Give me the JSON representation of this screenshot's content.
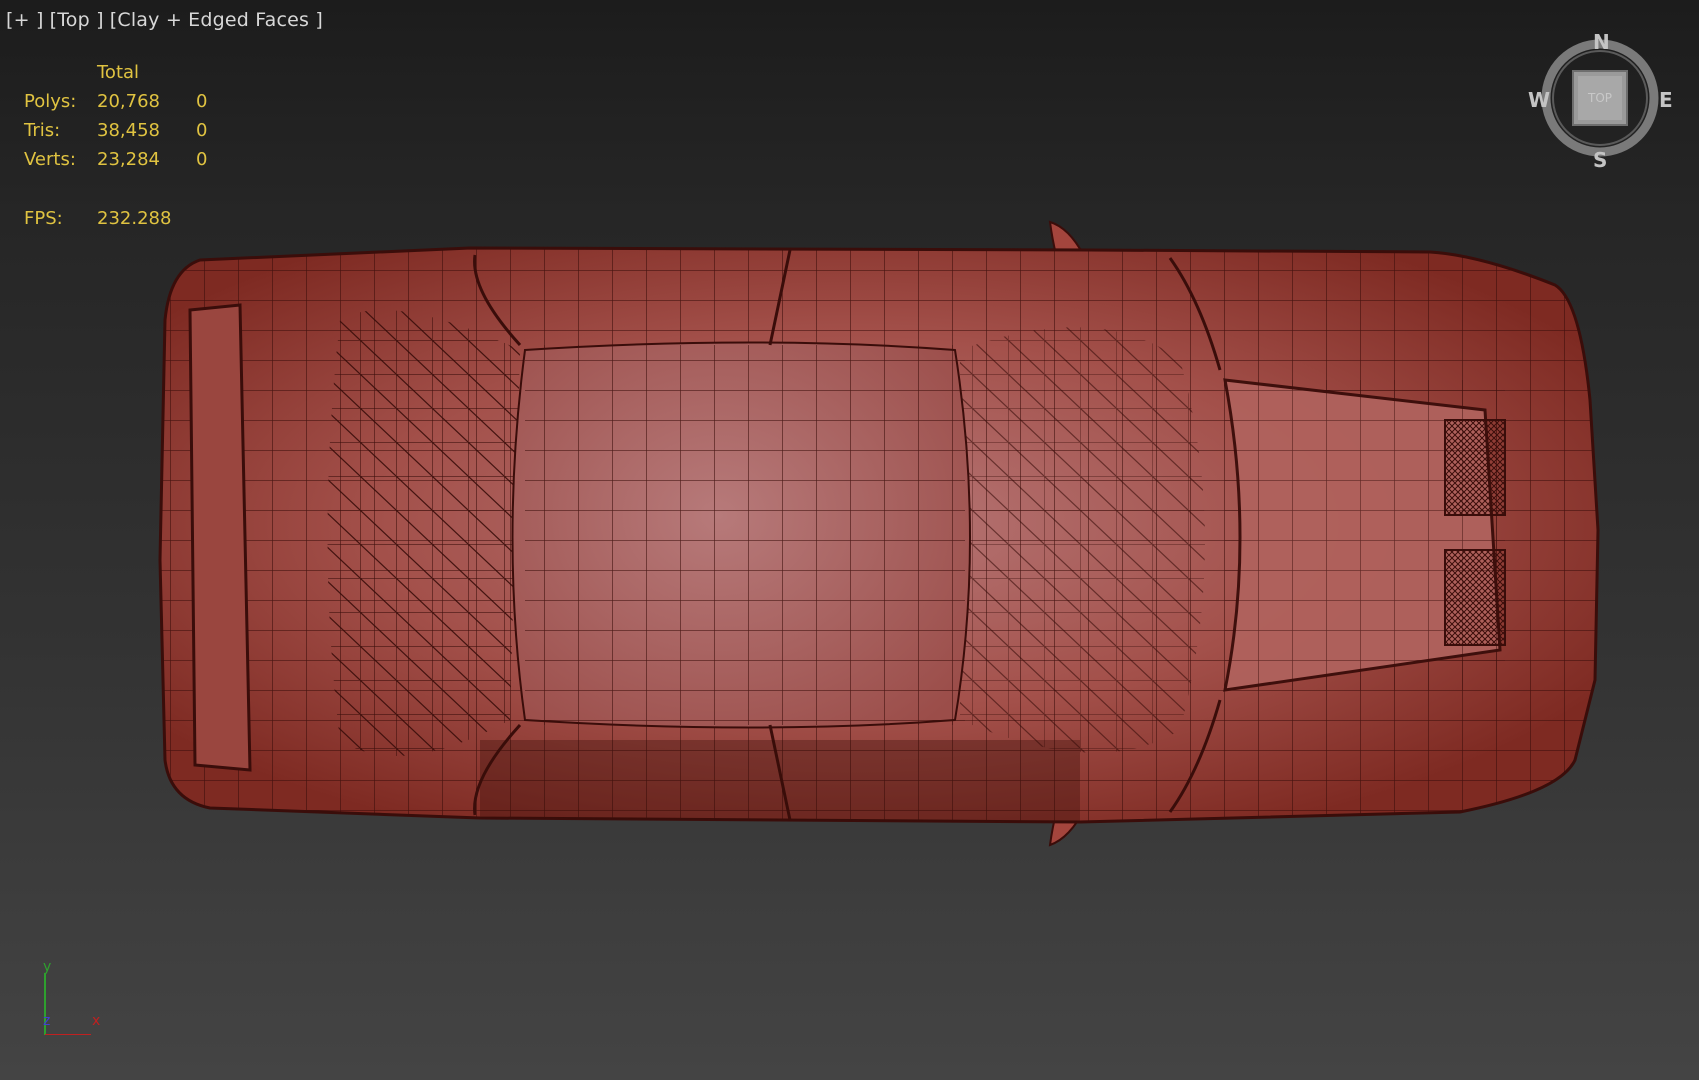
{
  "viewport": {
    "label_plus": "[+ ]",
    "label_view": "[Top ]",
    "label_shading": "[Clay + Edged Faces ]"
  },
  "stats": {
    "header": "Total",
    "rows": [
      {
        "label": "Polys:",
        "total": "20,768",
        "selected": "0"
      },
      {
        "label": "Tris:",
        "total": "38,458",
        "selected": "0"
      },
      {
        "label": "Verts:",
        "total": "23,284",
        "selected": "0"
      }
    ],
    "fps_label": "FPS:",
    "fps_value": "232.288"
  },
  "viewcube": {
    "north": "N",
    "south": "S",
    "east": "E",
    "west": "W",
    "face": "TOP"
  },
  "axis": {
    "y": "y",
    "z": "z",
    "x": "x"
  },
  "colors": {
    "model_fill": "#a0463f",
    "wire": "#3a0d0a",
    "stats_text": "#e0c341",
    "label_text": "#d8d8d8"
  }
}
